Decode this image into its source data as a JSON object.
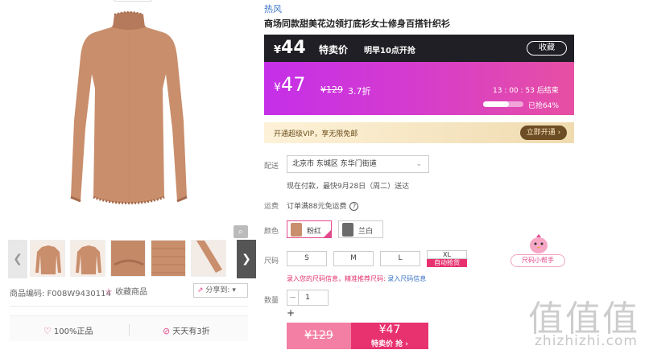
{
  "gallery": {
    "sku_label": "商品编码: F008W9430114",
    "fav_label": "收藏商品",
    "share_label": "分享到:",
    "promise_left": "100%正品",
    "promise_right": "天天有3折",
    "thumbnail_count": 5
  },
  "product": {
    "brand": "热风",
    "title": "商场同款甜美花边领打底衫女士修身百搭针织衫"
  },
  "vip_banner": {
    "currency": "¥",
    "price": "44",
    "tag": "特卖价",
    "time_note": "明早10点开抢",
    "collect": "收藏"
  },
  "flash_banner": {
    "currency": "¥",
    "price": "47",
    "original": "¥129",
    "discount": "3.7折",
    "countdown": "13 : 00 : 53  后结束",
    "sold_text": "已抢64%",
    "sold_fraction": 0.64
  },
  "super_vip": {
    "text": "开通超级VIP，享无限免邮",
    "button": "立即开通 ›"
  },
  "delivery": {
    "label": "配送",
    "address": "北京市 东城区 东华门街道",
    "note": "现在付款，最快9月28日（周二）送达"
  },
  "shipping": {
    "label": "运费",
    "text": "订单满88元免运费"
  },
  "colors": {
    "label": "颜色",
    "options": [
      {
        "name": "粉红",
        "swatch": "#c98e6c",
        "selected": true
      },
      {
        "name": "兰白",
        "swatch": "#6b6b6b",
        "selected": false
      }
    ]
  },
  "sizes": {
    "label": "尺码",
    "options": [
      "S",
      "M",
      "L",
      "XL"
    ],
    "xl_tag": "自动抢货"
  },
  "size_tip": {
    "text": "录入您的尺码信息，精准推荐尺码: ",
    "link": "录入尺码信息"
  },
  "size_helper": {
    "label": "尺码小帮手"
  },
  "quantity": {
    "label": "数量",
    "value": "1",
    "minus": "−",
    "plus": "+"
  },
  "buy": {
    "original": "¥129",
    "flash_price": "¥47",
    "flash_label": "特卖价 抢 ›"
  },
  "watermark": {
    "mark": "值值值",
    "text": "zhizhizhi.com"
  },
  "colors_theme": {
    "accent_pink": "#e8326f",
    "vip_dark": "#1f1f25",
    "link_blue": "#3973c4"
  }
}
